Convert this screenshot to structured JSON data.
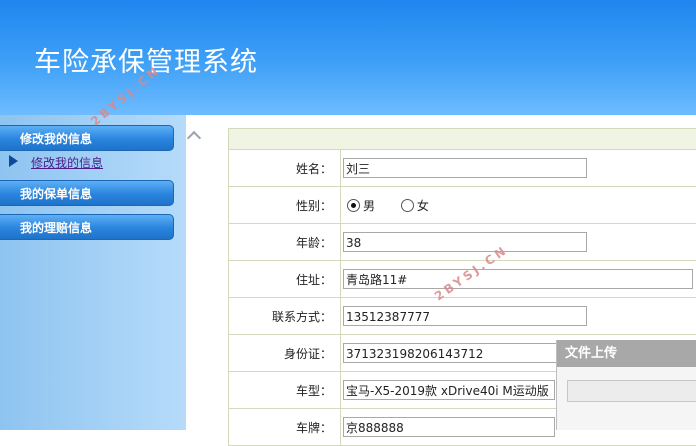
{
  "app": {
    "title": "车险承保管理系统"
  },
  "sidebar": {
    "menu_profile": "修改我的信息",
    "menu_profile_sub": "修改我的信息",
    "menu_policy": "我的保单信息",
    "menu_claims": "我的理赔信息"
  },
  "form": {
    "name_label": "姓名：",
    "name_value": "刘三",
    "gender_label": "性别：",
    "gender_male": "男",
    "gender_female": "女",
    "age_label": "年龄：",
    "age_value": "38",
    "address_label": "住址：",
    "address_value": "青岛路11#",
    "phone_label": "联系方式：",
    "phone_value": "13512387777",
    "idcard_label": "身份证：",
    "idcard_value": "371323198206143712",
    "car_model_label": "车型：",
    "car_model_value": "宝马-X5-2019款 xDrive40i M运动版",
    "plate_label": "车牌：",
    "plate_value": "京888888"
  },
  "upload": {
    "title": "文件上传"
  },
  "watermark": {
    "text1": "2BYSJ.CN",
    "text2": "2BYSJ.CN"
  }
}
